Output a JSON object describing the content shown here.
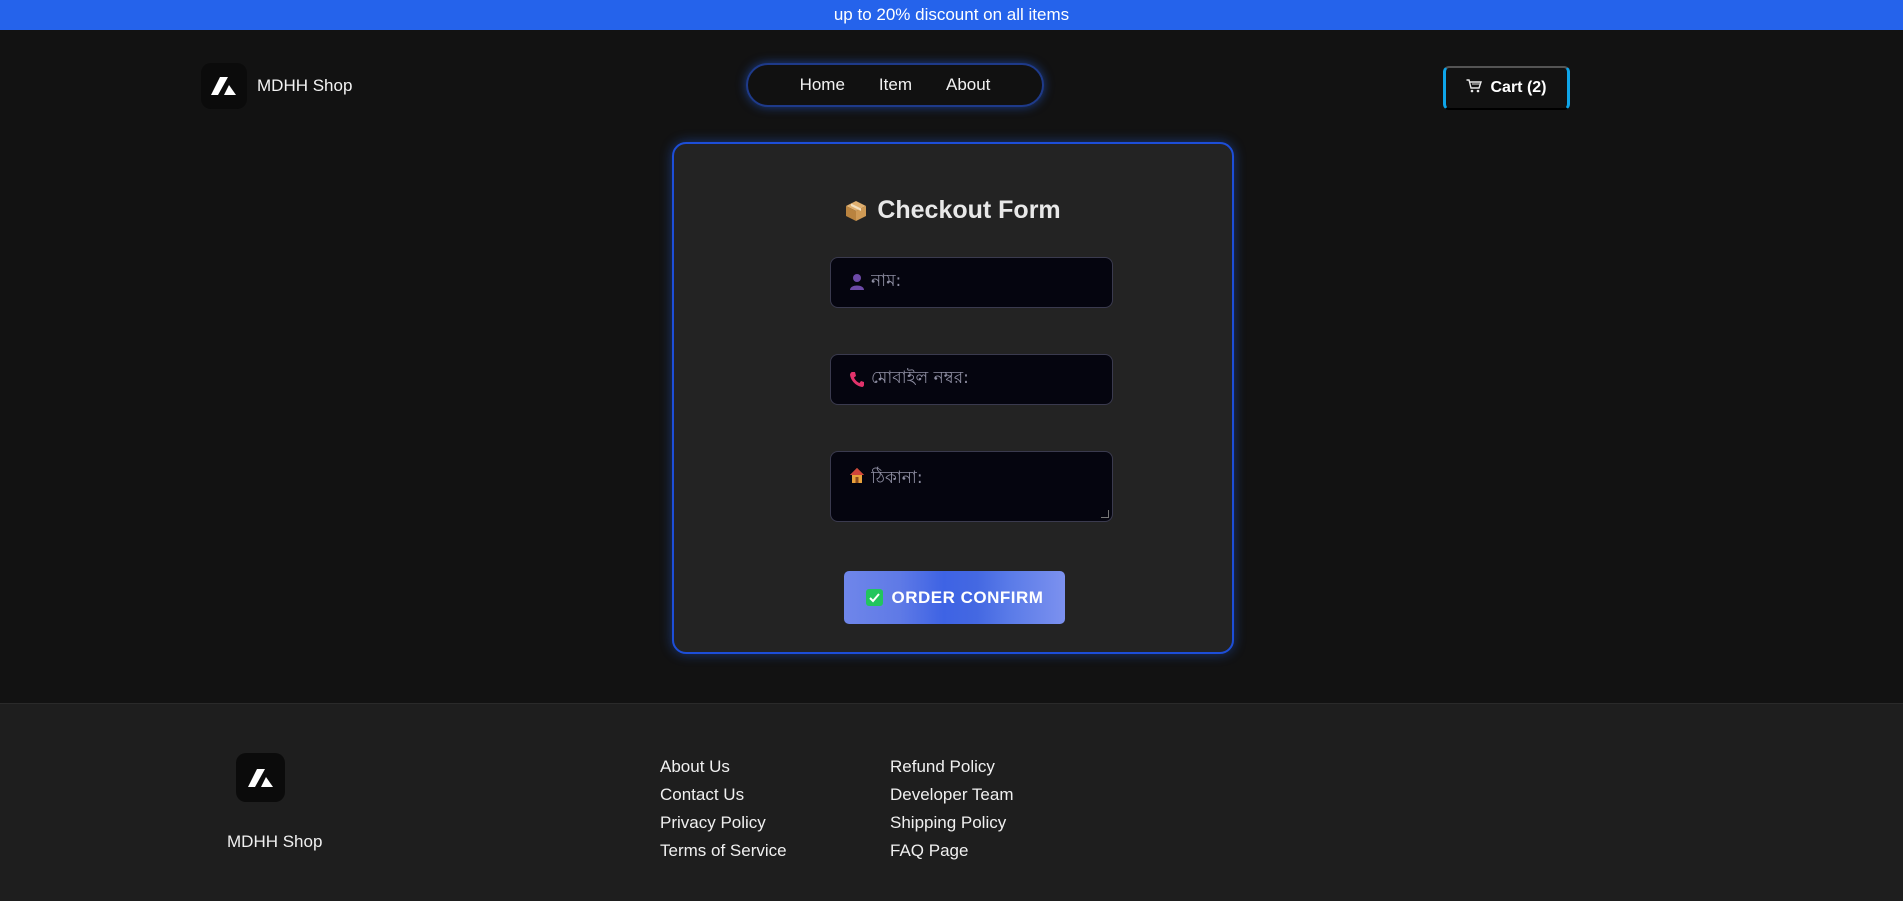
{
  "promo": {
    "text": "up to 20% discount on all items"
  },
  "header": {
    "brand_name": "MDHH Shop",
    "nav": [
      {
        "label": "Home"
      },
      {
        "label": "Item"
      },
      {
        "label": "About"
      }
    ],
    "cart": {
      "icon": "cart-icon",
      "label": "Cart (2)"
    }
  },
  "checkout": {
    "title_icon": "package-icon",
    "title": "Checkout Form",
    "fields": {
      "name": {
        "icon": "user-icon",
        "placeholder": "নাম:",
        "value": ""
      },
      "phone": {
        "icon": "phone-icon",
        "placeholder": "মোবাইল নম্বর:",
        "value": ""
      },
      "address": {
        "icon": "house-icon",
        "placeholder": "ঠিকানা:",
        "value": ""
      }
    },
    "submit": {
      "icon": "check-icon",
      "label": "ORDER CONFIRM"
    }
  },
  "footer": {
    "brand_name": "MDHH Shop",
    "col1": [
      {
        "label": "About Us"
      },
      {
        "label": "Contact Us"
      },
      {
        "label": "Privacy Policy"
      },
      {
        "label": "Terms of Service"
      }
    ],
    "col2": [
      {
        "label": "Refund Policy"
      },
      {
        "label": "Developer Team"
      },
      {
        "label": "Shipping Policy"
      },
      {
        "label": "FAQ Page"
      }
    ]
  },
  "colors": {
    "promo_bg": "#2563eb",
    "page_bg": "#121212",
    "card_bg": "#232323",
    "accent_blue": "#1d4ed8",
    "cart_border": "#0ea5e9",
    "footer_bg": "#1e1e1e"
  }
}
